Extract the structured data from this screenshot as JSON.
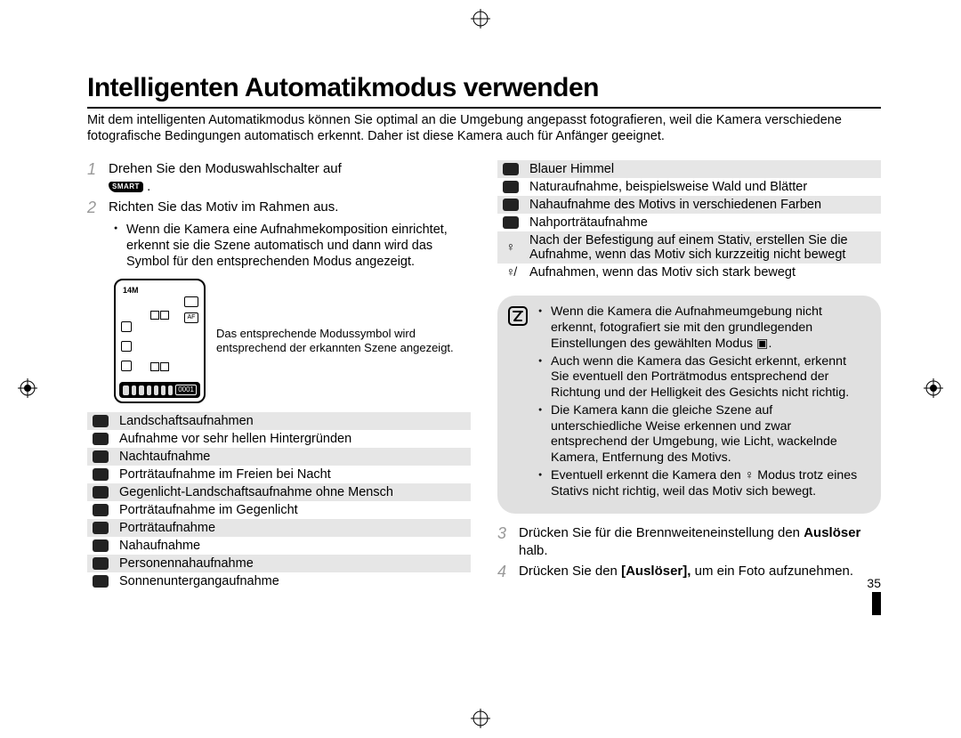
{
  "page_number": "35",
  "title": "Intelligenten Automatikmodus verwenden",
  "intro": "Mit dem intelligenten Automatikmodus können Sie optimal an die Umgebung angepasst fotografieren, weil die Kamera verschiedene fotografische Bedingungen automatisch erkennt. Daher ist diese Kamera auch für Anfänger geeignet.",
  "steps": {
    "s1": {
      "num": "1",
      "text": "Drehen Sie den Moduswahlschalter auf"
    },
    "s2": {
      "num": "2",
      "text": "Richten Sie das Motiv im Rahmen aus.",
      "bullet": "Wenn die Kamera eine Aufnahmekomposition einrichtet, erkennt sie die Szene automatisch und dann wird das Symbol für den entsprechenden Modus angezeigt."
    },
    "s3": {
      "num": "3",
      "text_a": "Drücken Sie für die Brennweiteneinstellung den ",
      "bold": "Auslöser",
      "text_b": " halb."
    },
    "s4": {
      "num": "4",
      "text_a": "Drücken Sie den ",
      "bold": "[Auslöser],",
      "text_b": " um ein Foto aufzunehmen."
    }
  },
  "lcd": {
    "res": "14M",
    "af": "AF",
    "counter": "0001"
  },
  "caption": "Das entsprechende Modussymbol wird entsprechend der erkannten Szene angezeigt.",
  "smart_label": "SMART",
  "modes_left": [
    {
      "label": "Landschaftsaufnahmen"
    },
    {
      "label": "Aufnahme vor sehr hellen Hintergründen"
    },
    {
      "label": "Nachtaufnahme"
    },
    {
      "label": "Porträtaufnahme im Freien bei Nacht"
    },
    {
      "label": "Gegenlicht-Landschaftsaufnahme ohne Mensch"
    },
    {
      "label": "Porträtaufnahme im Gegenlicht"
    },
    {
      "label": "Porträtaufnahme"
    },
    {
      "label": "Nahaufnahme"
    },
    {
      "label": "Personennahaufnahme"
    },
    {
      "label": "Sonnenuntergangaufnahme"
    }
  ],
  "modes_right": [
    {
      "label": "Blauer Himmel"
    },
    {
      "label": "Naturaufnahme, beispielsweise Wald und Blätter"
    },
    {
      "label": "Nahaufnahme des Motivs in verschiedenen Farben"
    },
    {
      "label": "Nahporträtaufnahme"
    },
    {
      "label": "Nach der Befestigung auf einem Stativ, erstellen Sie die Aufnahme, wenn das Motiv sich kurzzeitig nicht bewegt",
      "tripod": true
    },
    {
      "label": "Aufnahmen, wenn das Motiv sich stark bewegt",
      "tripod_strike": true
    }
  ],
  "note": [
    "Wenn die Kamera die Aufnahmeumgebung nicht erkennt, fotografiert sie mit den grundlegenden Einstellungen des gewählten Modus ▣.",
    "Auch wenn die Kamera das Gesicht erkennt, erkennt Sie eventuell den Porträtmodus entsprechend der Richtung und der Helligkeit des Gesichts nicht richtig.",
    "Die Kamera kann die gleiche Szene auf unterschiedliche Weise erkennen und zwar entsprechend der Umgebung, wie Licht, wackelnde Kamera, Entfernung des Motivs.",
    "Eventuell erkennt die Kamera den ♀ Modus trotz eines Stativs nicht richtig, weil das Motiv sich bewegt."
  ]
}
